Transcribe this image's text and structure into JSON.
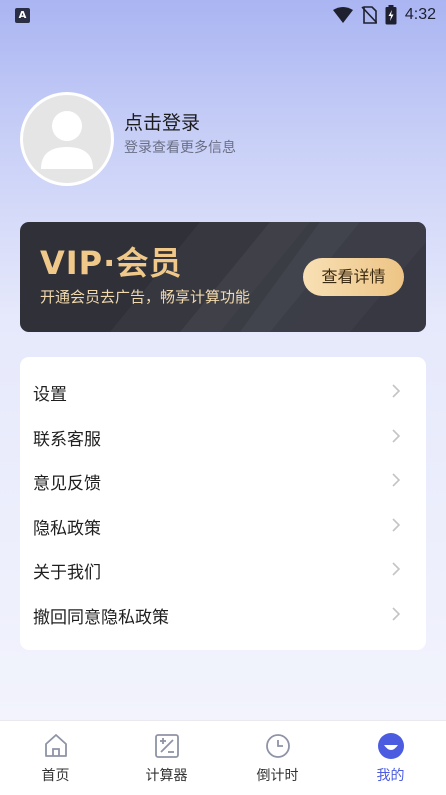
{
  "status_bar": {
    "app_badge": "A",
    "time": "4:32"
  },
  "profile": {
    "title": "点击登录",
    "subtitle": "登录查看更多信息"
  },
  "vip": {
    "title": "VIP·会员",
    "subtitle": "开通会员去广告，畅享计算功能",
    "button": "查看详情"
  },
  "menu": {
    "items": [
      {
        "label": "设置"
      },
      {
        "label": "联系客服"
      },
      {
        "label": "意见反馈"
      },
      {
        "label": "隐私政策"
      },
      {
        "label": "关于我们"
      },
      {
        "label": "撤回同意隐私政策"
      }
    ]
  },
  "tabs": [
    {
      "label": "首页",
      "icon": "home-icon"
    },
    {
      "label": "计算器",
      "icon": "calculator-icon"
    },
    {
      "label": "倒计时",
      "icon": "clock-icon"
    },
    {
      "label": "我的",
      "icon": "profile-icon",
      "active": true
    }
  ],
  "colors": {
    "accent": "#4b5ce0",
    "vip_gold": "#f0c98a",
    "vip_card": "#2f3038"
  }
}
